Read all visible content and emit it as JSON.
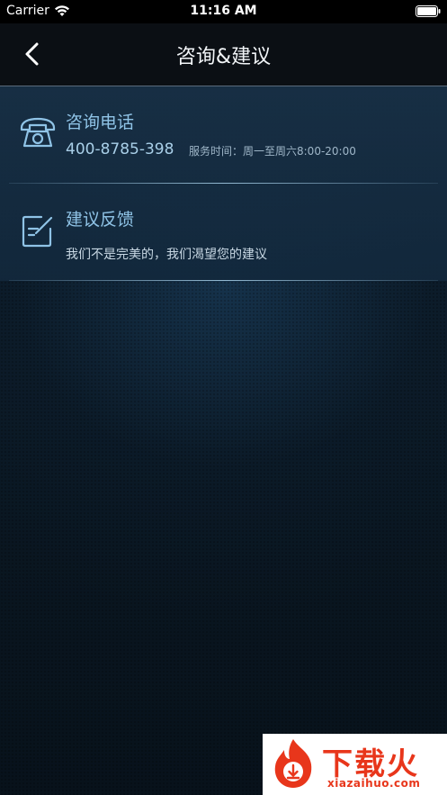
{
  "status_bar": {
    "carrier": "Carrier",
    "time": "11:16 AM"
  },
  "nav": {
    "title": "咨询&建议"
  },
  "items": [
    {
      "title": "咨询电话",
      "phone": "400-8785-398",
      "hours": "服务时间：周一至周六8:00-20:00",
      "icon": "telephone-icon"
    },
    {
      "title": "建议反馈",
      "subtitle": "我们不是完美的，我们渴望您的建议",
      "icon": "edit-note-icon"
    }
  ],
  "watermark": {
    "text": "下载火",
    "url": "xiazaihuo.com"
  },
  "colors": {
    "accent": "#8fc3e6",
    "nav_background": "#0b0f14",
    "watermark": "#e8361b"
  }
}
